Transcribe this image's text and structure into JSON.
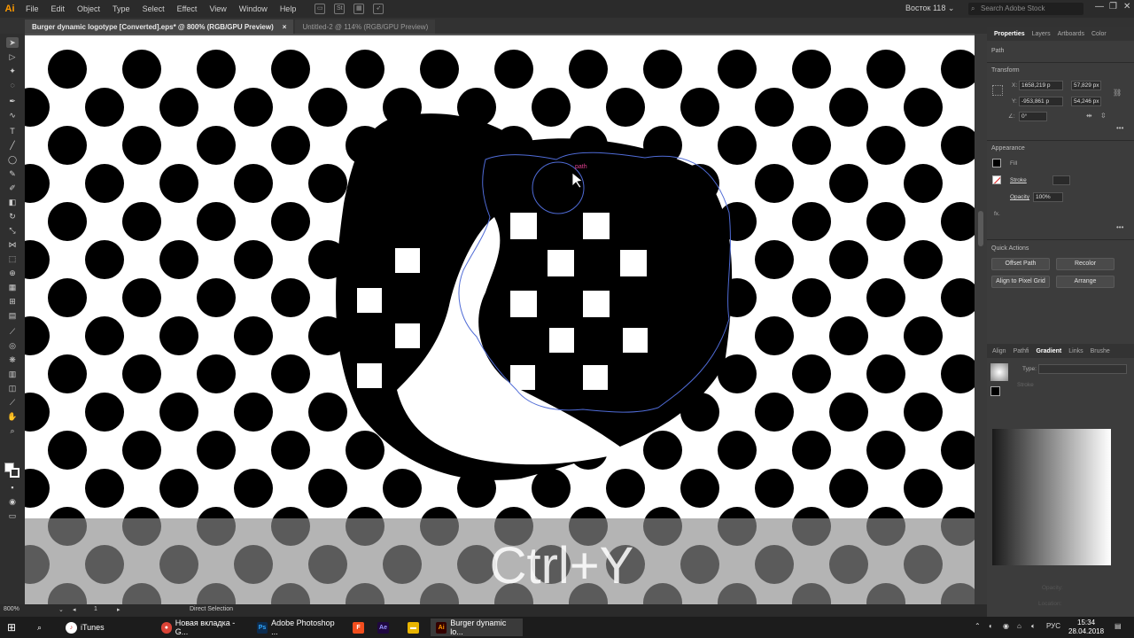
{
  "menubar": {
    "logo": "Ai",
    "items": [
      "File",
      "Edit",
      "Object",
      "Type",
      "Select",
      "Effect",
      "View",
      "Window",
      "Help"
    ],
    "workspace": "Восток 118",
    "search_placeholder": "Search Adobe Stock"
  },
  "tabs": [
    {
      "label": "Burger dynamic logotype [Converted].eps* @ 800% (RGB/GPU Preview)",
      "close": "×"
    },
    {
      "label": "Untitled-2 @ 114% (RGB/GPU Preview)",
      "close": ""
    }
  ],
  "canvas": {
    "caption": "Ctrl+Y",
    "hover_label": "path"
  },
  "status": {
    "zoom": "800%",
    "artboard": "1",
    "tool": "Direct Selection"
  },
  "panel": {
    "tabs": [
      "Properties",
      "Layers",
      "Artboards",
      "Color"
    ],
    "object_type": "Path",
    "transform": {
      "title": "Transform",
      "x_label": "X:",
      "x_value": "1658,219 p",
      "y_label": "Y:",
      "y_value": "-953,861 p",
      "w_label": "W:",
      "w_value": "57,829 px",
      "h_label": "H:",
      "h_value": "54,246 px",
      "angle_value": "0°"
    },
    "appearance": {
      "title": "Appearance",
      "fill": "Fill",
      "stroke": "Stroke",
      "opacity_label": "Opacity",
      "opacity_value": "100%",
      "fx": "fx."
    },
    "quick_actions": {
      "title": "Quick Actions",
      "buttons": [
        "Offset Path",
        "Recolor",
        "Align to Pixel Grid",
        "Arrange"
      ]
    },
    "lower_tabs": [
      "Align",
      "Pathfi",
      "Gradient",
      "Links",
      "Brushe"
    ],
    "gradient": {
      "type_label": "Type:",
      "stroke_label": "Stroke",
      "opacity_label": "Opacity:",
      "location_label": "Location:"
    }
  },
  "taskbar": {
    "items": [
      "iTunes",
      "Новая вкладка - G...",
      "Adobe Photoshop ...",
      "",
      "",
      "Burger dynamic lo..."
    ],
    "lang": "РУС",
    "time": "15:34",
    "date": "28.04.2018"
  },
  "colors": {
    "accent": "#ff9a00",
    "selection": "#4f6bd6",
    "hover_label": "#e0408f"
  }
}
